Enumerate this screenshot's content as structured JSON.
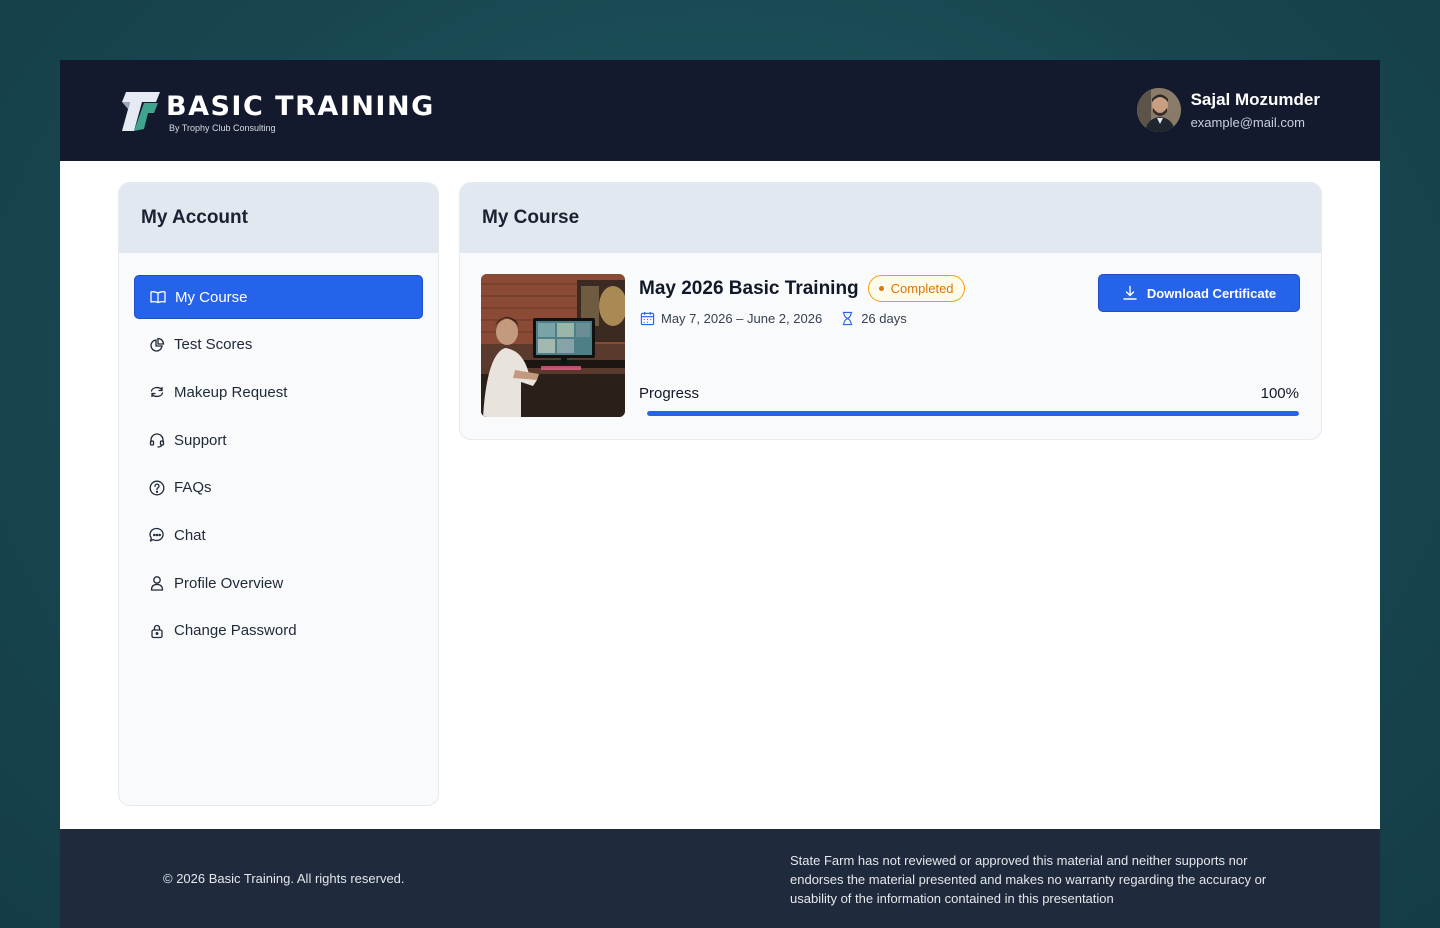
{
  "header": {
    "logo_title": "BASIC TRAINING",
    "logo_subtitle": "By Trophy Club Consulting",
    "user_name": "Sajal Mozumder",
    "user_email": "example@mail.com"
  },
  "sidebar": {
    "title": "My Account",
    "items": [
      {
        "label": "My Course",
        "icon": "book-open-icon",
        "active": true
      },
      {
        "label": "Test Scores",
        "icon": "chart-pie-icon",
        "active": false
      },
      {
        "label": "Makeup Request",
        "icon": "refresh-icon",
        "active": false
      },
      {
        "label": "Support",
        "icon": "headset-icon",
        "active": false
      },
      {
        "label": "FAQs",
        "icon": "question-circle-icon",
        "active": false
      },
      {
        "label": "Chat",
        "icon": "chat-bubble-icon",
        "active": false
      },
      {
        "label": "Profile Overview",
        "icon": "user-icon",
        "active": false
      },
      {
        "label": "Change Password",
        "icon": "lock-icon",
        "active": false
      }
    ]
  },
  "main": {
    "title": "My Course",
    "course": {
      "name": "May 2026 Basic Training",
      "status": "Completed",
      "dates": "May 7, 2026 – June 2, 2026",
      "duration": "26 days",
      "download_label": "Download Certificate",
      "progress_label": "Progress",
      "progress_text": "100%",
      "progress_fraction": 1.0
    }
  },
  "footer": {
    "copyright": "© 2026 Basic Training. All rights reserved.",
    "disclaimer": "State Farm has not reviewed or approved this material and neither supports nor endorses the material presented and makes no warranty regarding the accuracy or usability of the information contained in this presentation"
  },
  "colors": {
    "accent": "#2563eb",
    "header_bg": "#131a2d",
    "footer_bg": "#1f2a3d",
    "status_completed": "#d97706"
  }
}
